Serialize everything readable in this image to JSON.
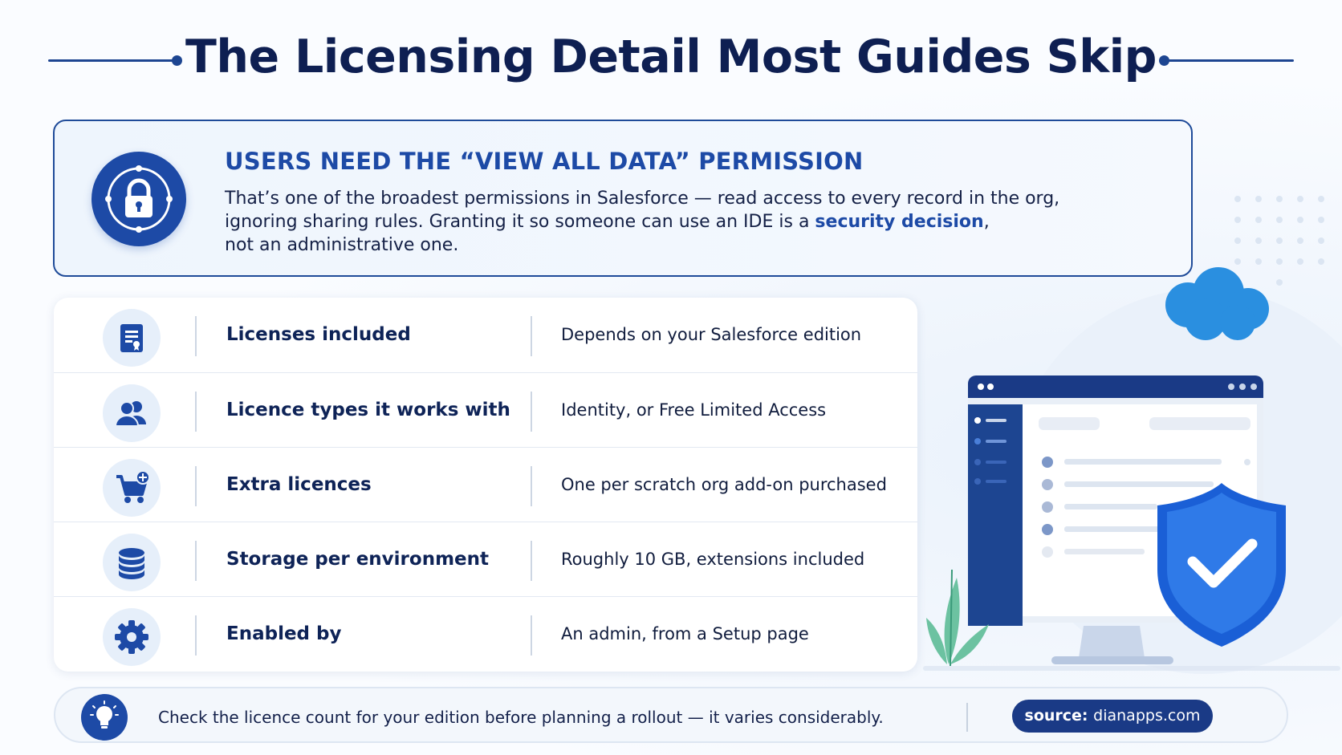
{
  "title": "The Licensing Detail Most Guides Skip",
  "callout": {
    "heading": "USERS NEED THE “VIEW ALL DATA” PERMISSION",
    "line1": "That’s one of the broadest permissions in Salesforce — read access to every record in the org,",
    "line2_before": "ignoring sharing rules. Granting it so someone can use an IDE is a ",
    "line2_highlight": "security decision",
    "line2_after": ",",
    "line3": "not an administrative one.",
    "icon": "lock-icon"
  },
  "rows": [
    {
      "icon": "license-document-icon",
      "label": "Licenses included",
      "value": "Depends on your Salesforce edition"
    },
    {
      "icon": "users-icon",
      "label": "Licence types it works with",
      "value": "Identity, or Free Limited Access"
    },
    {
      "icon": "cart-add-icon",
      "label": "Extra licences",
      "value": "One per scratch org add-on purchased"
    },
    {
      "icon": "database-icon",
      "label": "Storage per environment",
      "value": "Roughly 10 GB, extensions included"
    },
    {
      "icon": "gear-icon",
      "label": "Enabled by",
      "value": "An admin, from a Setup page"
    }
  ],
  "footer": {
    "icon": "lightbulb-icon",
    "text": "Check the licence count for your edition before planning a rollout — it varies considerably.",
    "source_label": "source:",
    "source_value": "dianapps.com"
  },
  "colors": {
    "title": "#0e1f52",
    "accent": "#1d4aa6",
    "navy": "#1a3a86",
    "cloud": "#2a8fe0"
  }
}
